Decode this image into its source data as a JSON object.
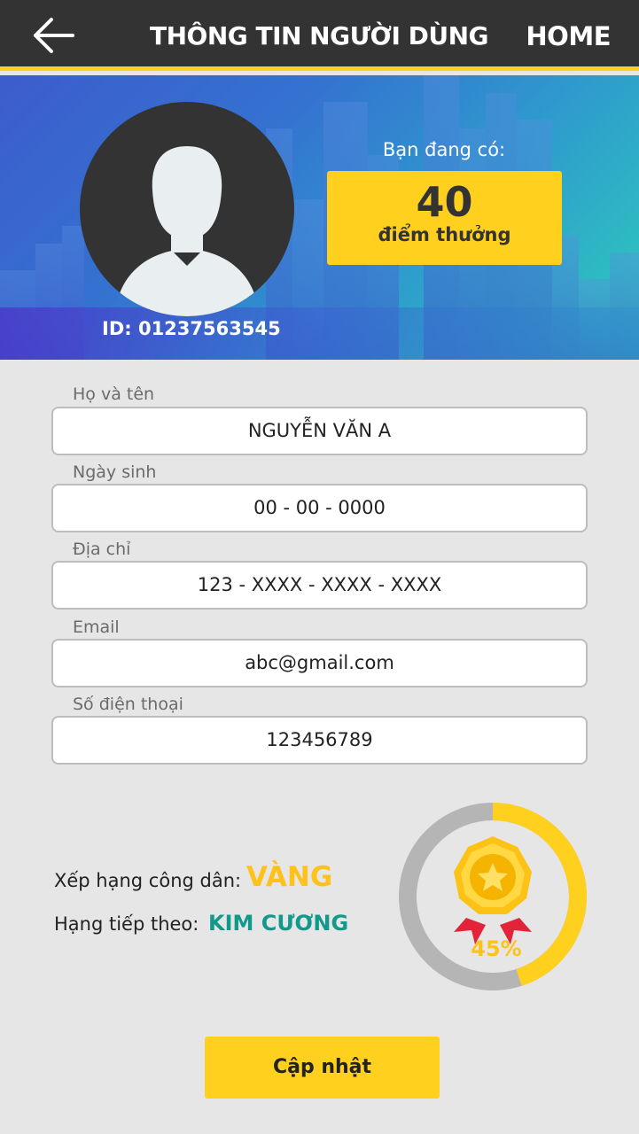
{
  "header": {
    "back_icon": "arrow-left-icon",
    "title": "THÔNG TIN NGƯỜI DÙNG",
    "home_label": "HOME"
  },
  "profile": {
    "avatar_icon": "user-silhouette-icon",
    "id_text": "ID: 01237563545",
    "points_caption": "Bạn đang có:",
    "points_value": "40",
    "points_unit": "điểm thưởng"
  },
  "form": {
    "fields": [
      {
        "label": "Họ và tên",
        "value": "NGUYỄN VĂN A"
      },
      {
        "label": "Ngày sinh",
        "value": "00 - 00 - 0000"
      },
      {
        "label": "Địa chỉ",
        "value": "123 - XXXX - XXXX - XXXX"
      },
      {
        "label": "Email",
        "value": "abc@gmail.com"
      },
      {
        "label": "Số điện thoại",
        "value": "123456789"
      }
    ]
  },
  "rank": {
    "current_label": "Xếp hạng công dân:",
    "current_value": "VÀNG",
    "next_label": "Hạng tiếp theo:",
    "next_value": "KIM CƯƠNG",
    "progress_text": "45%",
    "progress_fraction": 0.45,
    "medal_icon": "star-medal-icon"
  },
  "actions": {
    "update_label": "Cập nhật"
  },
  "colors": {
    "header_bg": "#333333",
    "accent_yellow": "#ffd01e",
    "gold_text": "#ffc21a",
    "teal_text": "#119a8c",
    "page_bg": "#e6e6e6",
    "ring_track": "#b5b5b5"
  }
}
